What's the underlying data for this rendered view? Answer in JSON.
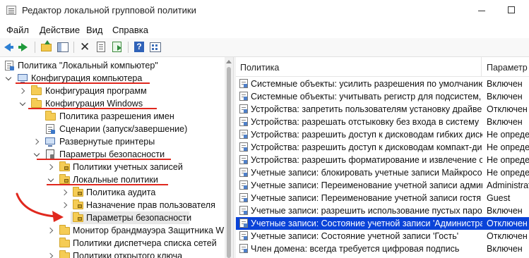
{
  "window": {
    "title": "Редактор локальной групповой политики"
  },
  "menu": [
    "Файл",
    "Действие",
    "Вид",
    "Справка"
  ],
  "toolbar": {
    "icons": [
      "back-arrow-icon",
      "forward-arrow-icon",
      "folder-up-icon",
      "show-hide-tree-icon",
      "delete-icon",
      "properties-icon",
      "export-list-icon",
      "help-icon",
      "view-icon"
    ]
  },
  "tree": {
    "items": [
      {
        "label": "Политика \"Локальный компьютер\"",
        "icon": "policy-doc-icon"
      },
      {
        "label": "Конфигурация компьютера",
        "icon": "computer-icon",
        "expanded": true
      },
      {
        "label": "Конфигурация программ",
        "icon": "folder-icon",
        "expanded": false
      },
      {
        "label": "Конфигурация Windows",
        "icon": "folder-icon",
        "expanded": true
      },
      {
        "label": "Политика разрешения имен",
        "icon": "folder-icon"
      },
      {
        "label": "Сценарии (запуск/завершение)",
        "icon": "script-icon"
      },
      {
        "label": "Развернутые принтеры",
        "icon": "printer-icon",
        "expanded": false
      },
      {
        "label": "Параметры безопасности",
        "icon": "security-icon",
        "expanded": true
      },
      {
        "label": "Политики учетных записей",
        "icon": "folder-icon",
        "expanded": false
      },
      {
        "label": "Локальные политики",
        "icon": "folder-icon",
        "expanded": true
      },
      {
        "label": "Политика аудита",
        "icon": "folder-icon",
        "expanded": false
      },
      {
        "label": "Назначение прав пользователя",
        "icon": "folder-icon",
        "expanded": false
      },
      {
        "label": "Параметры безопасности",
        "icon": "folder-icon",
        "selected": true
      },
      {
        "label": "Монитор брандмауэра Защитника W",
        "icon": "folder-icon",
        "expanded": false
      },
      {
        "label": "Политики диспетчера списка сетей",
        "icon": "folder-icon"
      },
      {
        "label": "Политики открытого ключа",
        "icon": "folder-icon",
        "expanded": false
      }
    ]
  },
  "list": {
    "columns": [
      "Политика",
      "Параметр б"
    ],
    "rows": [
      {
        "policy": "Системные объекты: усилить разрешения по умолчанию для внутренних системных объектов",
        "value": "Включен"
      },
      {
        "policy": "Системные объекты: учитывать регистр для подсистем, отличных от Windows",
        "value": "Включен"
      },
      {
        "policy": "Устройства: запретить пользователям установку драйверов принтера",
        "value": "Отключен"
      },
      {
        "policy": "Устройства: разрешать отстыковку без входа в систему",
        "value": "Включен"
      },
      {
        "policy": "Устройства: разрешить доступ к дисководам гибких дисков",
        "value": "Не определ"
      },
      {
        "policy": "Устройства: разрешить доступ к дисководам компакт-дисков",
        "value": "Не определ"
      },
      {
        "policy": "Устройства: разрешить форматирование и извлечение съемных носителей",
        "value": "Не определ"
      },
      {
        "policy": "Учетные записи: блокировать учетные записи Майкрософт",
        "value": "Не определ"
      },
      {
        "policy": "Учетные записи: Переименование учетной записи администратора",
        "value": "Administrat"
      },
      {
        "policy": "Учетные записи: Переименование учетной записи гостя",
        "value": "Guest"
      },
      {
        "policy": "Учетные записи: разрешить использование пустых паролей",
        "value": "Включен"
      },
      {
        "policy": "Учетные записи: Состояние учетной записи 'Администратор'",
        "value": "Отключен",
        "selected": true
      },
      {
        "policy": "Учетные записи: Состояние учетной записи 'Гость'",
        "value": "Отключен"
      },
      {
        "policy": "Член домена: всегда требуется цифровая подпись",
        "value": "Включен"
      }
    ]
  },
  "annotations": {
    "color": "#e0281e"
  }
}
